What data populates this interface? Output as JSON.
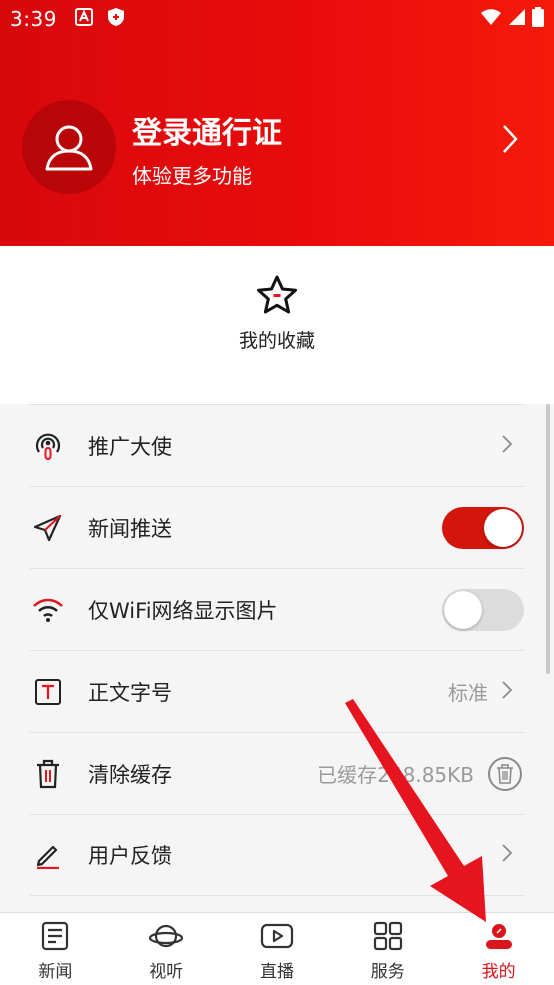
{
  "status_bar": {
    "time": "3:39"
  },
  "header": {
    "login_title": "登录通行证",
    "login_subtitle": "体验更多功能",
    "bg_color": "#e80c0c"
  },
  "favorites": {
    "label": "我的收藏",
    "icon": "star-icon"
  },
  "settings": {
    "items": [
      {
        "label": "推广大使",
        "icon": "ambassador-icon"
      },
      {
        "label": "新闻推送",
        "icon": "send-icon",
        "toggle": true
      },
      {
        "label": "仅WiFi网络显示图片",
        "icon": "wifi-icon",
        "toggle": false
      },
      {
        "label": "正文字号",
        "icon": "text-size-icon",
        "value": "标准"
      },
      {
        "label": "清除缓存",
        "icon": "trash-icon",
        "value": "已缓存248.85KB"
      },
      {
        "label": "用户反馈",
        "icon": "pencil-icon"
      }
    ]
  },
  "bottom_nav": {
    "items": [
      {
        "label": "新闻",
        "icon": "news-icon"
      },
      {
        "label": "视听",
        "icon": "planet-icon"
      },
      {
        "label": "直播",
        "icon": "play-icon"
      },
      {
        "label": "服务",
        "icon": "grid-icon"
      },
      {
        "label": "我的",
        "icon": "profile-icon",
        "active": true
      }
    ]
  },
  "colors": {
    "accent": "#d9161b",
    "toggle_on": "#d3150d",
    "annotation_arrow": "#e5141e"
  }
}
